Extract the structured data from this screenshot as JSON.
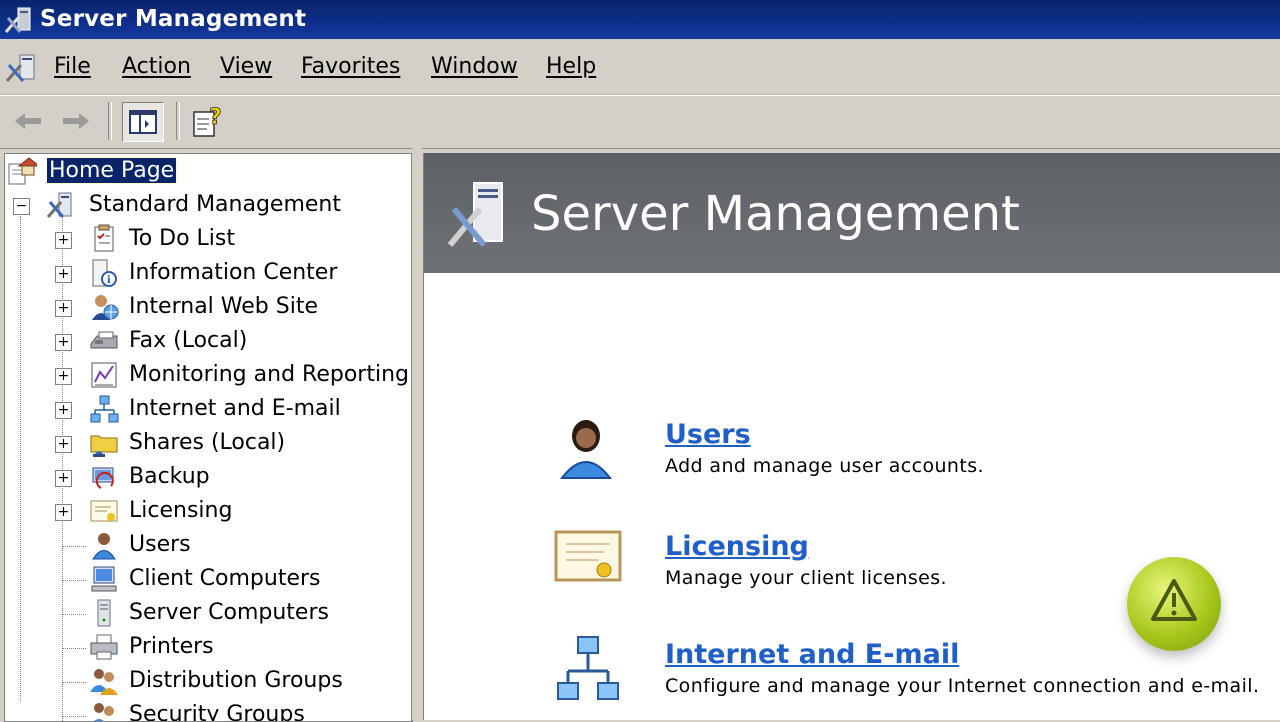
{
  "window": {
    "title": "Server Management"
  },
  "menu": {
    "items": [
      "File",
      "Action",
      "View",
      "Favorites",
      "Window",
      "Help"
    ]
  },
  "toolbar": {
    "buttons": [
      "back-arrow-icon",
      "forward-arrow-icon",
      "show-hide-tree-icon",
      "help-icon"
    ]
  },
  "tree": {
    "home": "Home Page",
    "root": "Standard Management",
    "items": [
      {
        "label": "To Do List",
        "icon": "todo-list-icon",
        "expandable": true
      },
      {
        "label": "Information Center",
        "icon": "information-center-icon",
        "expandable": true
      },
      {
        "label": "Internal Web Site",
        "icon": "internal-web-site-icon",
        "expandable": true
      },
      {
        "label": "Fax (Local)",
        "icon": "fax-icon",
        "expandable": true
      },
      {
        "label": "Monitoring and Reporting",
        "icon": "monitoring-icon",
        "expandable": true
      },
      {
        "label": "Internet and E-mail",
        "icon": "network-icon",
        "expandable": true
      },
      {
        "label": "Shares (Local)",
        "icon": "shared-folder-icon",
        "expandable": true
      },
      {
        "label": "Backup",
        "icon": "backup-icon",
        "expandable": true
      },
      {
        "label": "Licensing",
        "icon": "license-icon",
        "expandable": true
      },
      {
        "label": "Users",
        "icon": "user-icon",
        "expandable": false
      },
      {
        "label": "Client Computers",
        "icon": "client-computer-icon",
        "expandable": false
      },
      {
        "label": "Server Computers",
        "icon": "server-computer-icon",
        "expandable": false
      },
      {
        "label": "Printers",
        "icon": "printer-icon",
        "expandable": false
      },
      {
        "label": "Distribution Groups",
        "icon": "distribution-group-icon",
        "expandable": false
      },
      {
        "label": "Security Groups",
        "icon": "security-group-icon",
        "expandable": false
      }
    ]
  },
  "content": {
    "banner_title": "Server Management",
    "tasks": [
      {
        "title": "Users",
        "description": "Add and manage user accounts.",
        "icon": "user-icon"
      },
      {
        "title": "Licensing",
        "description": "Manage your client licenses.",
        "icon": "certificate-icon"
      },
      {
        "title": "Internet and E-mail",
        "description": "Configure and manage your Internet connection and e-mail.",
        "icon": "network-icon"
      }
    ]
  },
  "colors": {
    "titlebar": "#0a246a",
    "link": "#1f60c8",
    "banner": "#62666b",
    "chrome": "#d4d0c8"
  }
}
